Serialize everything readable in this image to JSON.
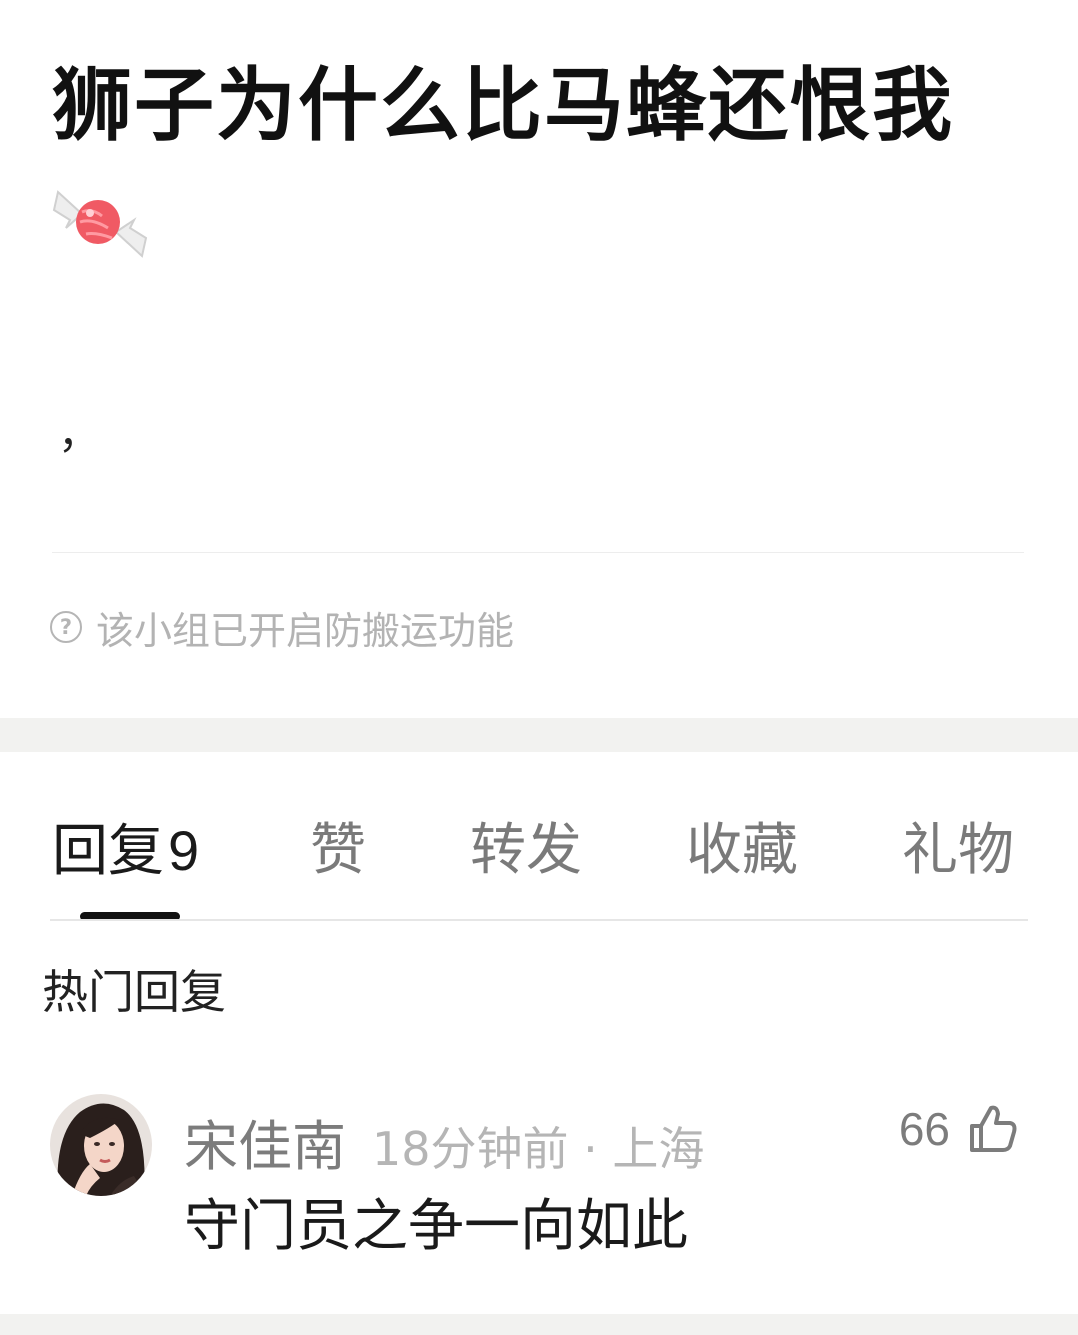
{
  "post": {
    "title": "狮子为什么比马蜂还恨我",
    "emoji_icon": "candy-icon",
    "body_text": "，",
    "notice_icon": "question-circle-icon",
    "notice_text": "该小组已开启防搬运功能"
  },
  "tabs": [
    {
      "label": "回复",
      "count": "9",
      "active": true
    },
    {
      "label": "赞",
      "active": false
    },
    {
      "label": "转发",
      "active": false
    },
    {
      "label": "收藏",
      "active": false
    },
    {
      "label": "礼物",
      "active": false
    }
  ],
  "section_title": "热门回复",
  "comment": {
    "username": "宋佳南",
    "time": "18分钟前 · 上海",
    "likes": "66",
    "like_icon": "thumbs-up-icon",
    "text": "守门员之争一向如此"
  },
  "colors": {
    "background": "#ffffff",
    "section_gap": "#f2f2f0",
    "active_tab": "#1a1a1a",
    "inactive_tab": "#7a7a7a",
    "muted_text": "#b5b5b5"
  }
}
